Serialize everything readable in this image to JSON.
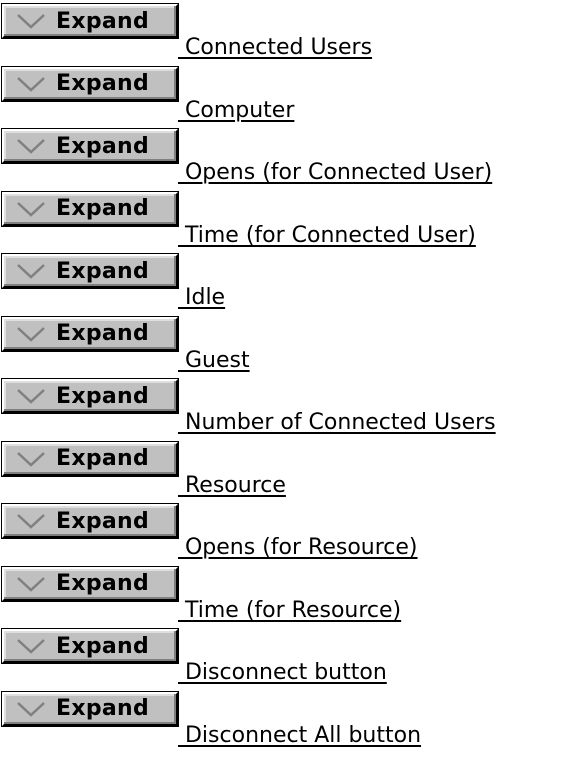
{
  "button_label": "Expand",
  "chevron_icon": "chevron-down-icon",
  "items": [
    {
      "label": " Connected Users"
    },
    {
      "label": " Computer"
    },
    {
      "label": " Opens (for Connected User)"
    },
    {
      "label": " Time (for Connected User)"
    },
    {
      "label": " Idle"
    },
    {
      "label": " Guest"
    },
    {
      "label": " Number of Connected Users"
    },
    {
      "label": " Resource"
    },
    {
      "label": " Opens (for Resource)"
    },
    {
      "label": " Time (for Resource)"
    },
    {
      "label": " Disconnect button"
    },
    {
      "label": " Disconnect All button"
    }
  ]
}
